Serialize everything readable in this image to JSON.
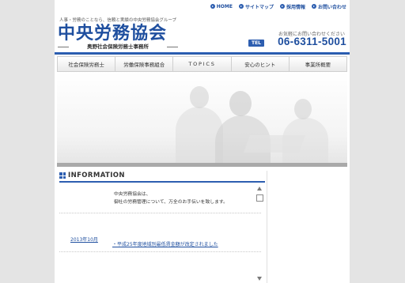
{
  "header": {
    "tagline": "人事・労務のことなら、信頼と実績の中央労務協会グループ",
    "brand_name": "中央労務協会",
    "brand_sub": "奥野社会保険労務士事務所",
    "contact_note": "お気軽にお問い合わせください",
    "tel_label": "TEL",
    "tel_number": "06-6311-5001"
  },
  "topnav": [
    {
      "label": "HOME",
      "icon": "circle-arrow-icon"
    },
    {
      "label": "サイトマップ",
      "icon": "circle-arrow-icon"
    },
    {
      "label": "採用情報",
      "icon": "circle-arrow-icon"
    },
    {
      "label": "お問い合わせ",
      "icon": "circle-arrow-icon"
    }
  ],
  "mainnav": [
    {
      "label": "社会保険労務士"
    },
    {
      "label": "労働保険事務組合"
    },
    {
      "label": "TOPICS"
    },
    {
      "label": "安心のヒント"
    },
    {
      "label": "事業所概要"
    }
  ],
  "information": {
    "title": "INFORMATION",
    "intro_lines": [
      "中央労務協会は、",
      "御社の労務管理について、万全のお手伝いを致します。"
    ],
    "news": [
      {
        "date": "2013年10月",
        "text": "・平成25年度地域別最低賃金額が改定されました"
      }
    ]
  },
  "colors": {
    "brand_blue": "#1f4f9f",
    "accent_blue": "#2d5eb0",
    "background_grey": "#e4e4e4"
  }
}
